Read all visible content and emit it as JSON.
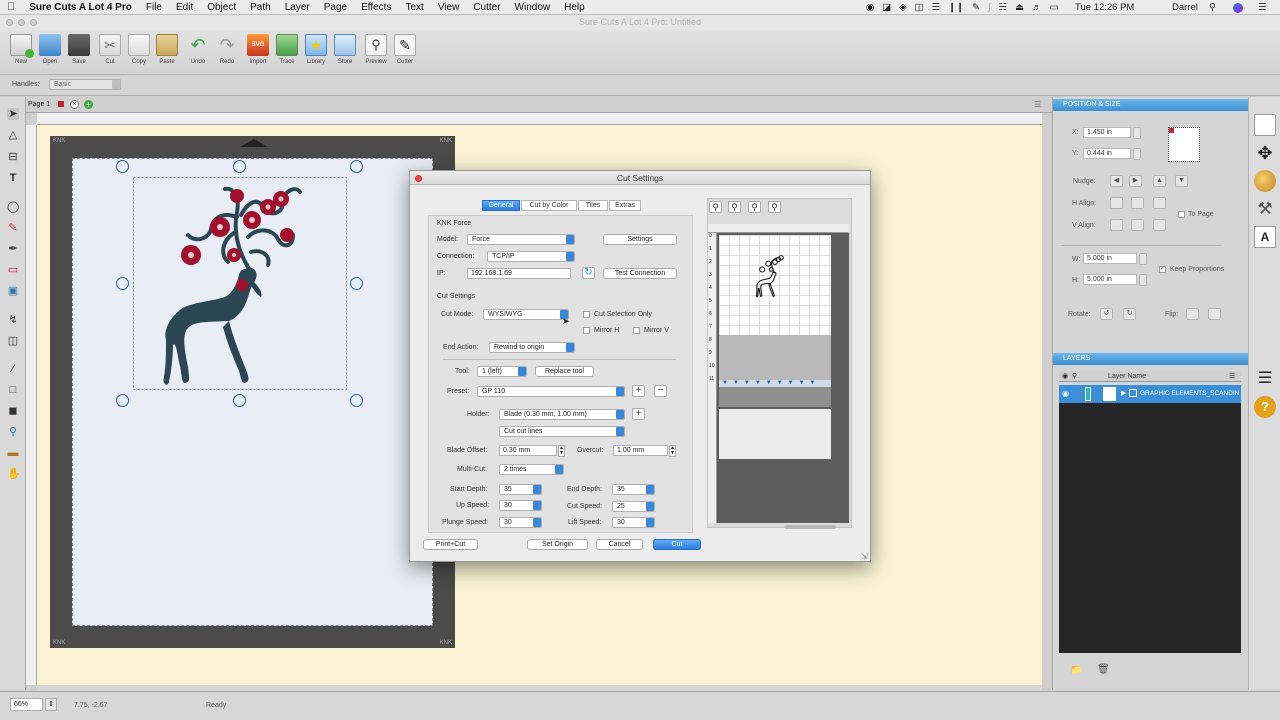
{
  "menubar": {
    "apple": "",
    "items": [
      "Sure Cuts A Lot 4 Pro",
      "File",
      "Edit",
      "Object",
      "Path",
      "Layer",
      "Page",
      "Effects",
      "Text",
      "View",
      "Cutter",
      "Window",
      "Help"
    ],
    "clock": "Tue 12:26 PM",
    "user": "Darrel"
  },
  "window": {
    "title": "Sure Cuts A Lot 4 Pro: Untitled"
  },
  "toolbar": {
    "buttons": [
      "New",
      "Open",
      "Save",
      "Cut",
      "Copy",
      "Paste",
      "Undo",
      "Redo",
      "Import",
      "Trace",
      "Library",
      "Store",
      "Preview",
      "Cutter"
    ]
  },
  "handles": {
    "label": "Handles:",
    "value": "Basic"
  },
  "page_tab": {
    "label": "Page 1"
  },
  "mat": {
    "brand_tl": "KNK",
    "brand_tr": "KNK",
    "brand_bl": "KNK",
    "brand_br": "KNK"
  },
  "status": {
    "zoom": "66%",
    "coords": "7.75, -2.67",
    "state": "Ready"
  },
  "position_panel": {
    "title": "POSITION & SIZE",
    "x_label": "X:",
    "x_value": "1.450 in",
    "y_label": "Y:",
    "y_value": "0.444 in",
    "nudge_label": "Nudge:",
    "halign_label": "H Align:",
    "valign_label": "V Align:",
    "to_page_label": "To Page",
    "w_label": "W:",
    "w_value": "5.000 in",
    "h_label": "H:",
    "h_value": "5.000 in",
    "keep_proportions_label": "Keep Proportions",
    "keep_proportions": true,
    "rotate_label": "Rotate:",
    "flip_label": "Flip:"
  },
  "layers_panel": {
    "title": "LAYERS",
    "column_header": "Layer Name",
    "layer_name": "GRAPHIC ELEMENTS_SCANDIN"
  },
  "dialog": {
    "title": "Cut Settings",
    "tabs": [
      "General",
      "Cut by Color",
      "Tiles",
      "Extras"
    ],
    "active_tab": "General",
    "knk_section": "KNK Force",
    "model_label": "Model:",
    "model_value": "Force",
    "settings_button": "Settings",
    "connection_label": "Connection:",
    "connection_value": "TCP/IP",
    "ip_label": "IP:",
    "ip_value": "192.168.1.69",
    "test_connection_button": "Test Connection",
    "cut_settings_section": "Cut Settings",
    "cut_mode_label": "Cut Mode:",
    "cut_mode_value": "WYSIWYG",
    "cut_selection_only_label": "Cut Selection Only",
    "mirror_h_label": "Mirror H",
    "mirror_v_label": "Mirror V",
    "end_action_label": "End Action:",
    "end_action_value": "Rewind to origin",
    "tool_label": "Tool:",
    "tool_value": "1 (left)",
    "replace_tool_button": "Replace tool",
    "preset_label": "Preset:",
    "preset_value": "GP 110",
    "holder_label": "Holder:",
    "holder_value": "Blade (0.30 mm, 1.00 mm)",
    "cut_lines_value": "Cut cut lines",
    "blade_offset_label": "Blade Offset:",
    "blade_offset_value": "0.30 mm",
    "overcut_label": "Overcut:",
    "overcut_value": "1.00 mm",
    "multicut_label": "Multi-Cut:",
    "multicut_value": "2 times",
    "start_depth_label": "Start Depth:",
    "start_depth_value": "35",
    "end_depth_label": "End Depth:",
    "end_depth_value": "35",
    "up_speed_label": "Up Speed:",
    "up_speed_value": "30",
    "cut_speed_label": "Cut Speed:",
    "cut_speed_value": "25",
    "plunge_speed_label": "Plunge Speed:",
    "plunge_speed_value": "30",
    "lift_speed_label": "Lift Speed:",
    "lift_speed_value": "30",
    "print_cut_button": "Print+Cut",
    "set_origin_button": "Set Origin",
    "cancel_button": "Cancel",
    "cut_button": "Cut",
    "preview_ruler_ticks": [
      "0",
      "1",
      "2",
      "3",
      "4",
      "5",
      "6",
      "7",
      "8",
      "9",
      "10",
      "11"
    ]
  },
  "colors": {
    "accent_blue": "#2a7ee0",
    "panel_header": "#4a9ee0",
    "mat": "#4b4b4b",
    "canvas": "#faf4d4",
    "deer": "#2c4654",
    "flowers": "#a3102e"
  }
}
